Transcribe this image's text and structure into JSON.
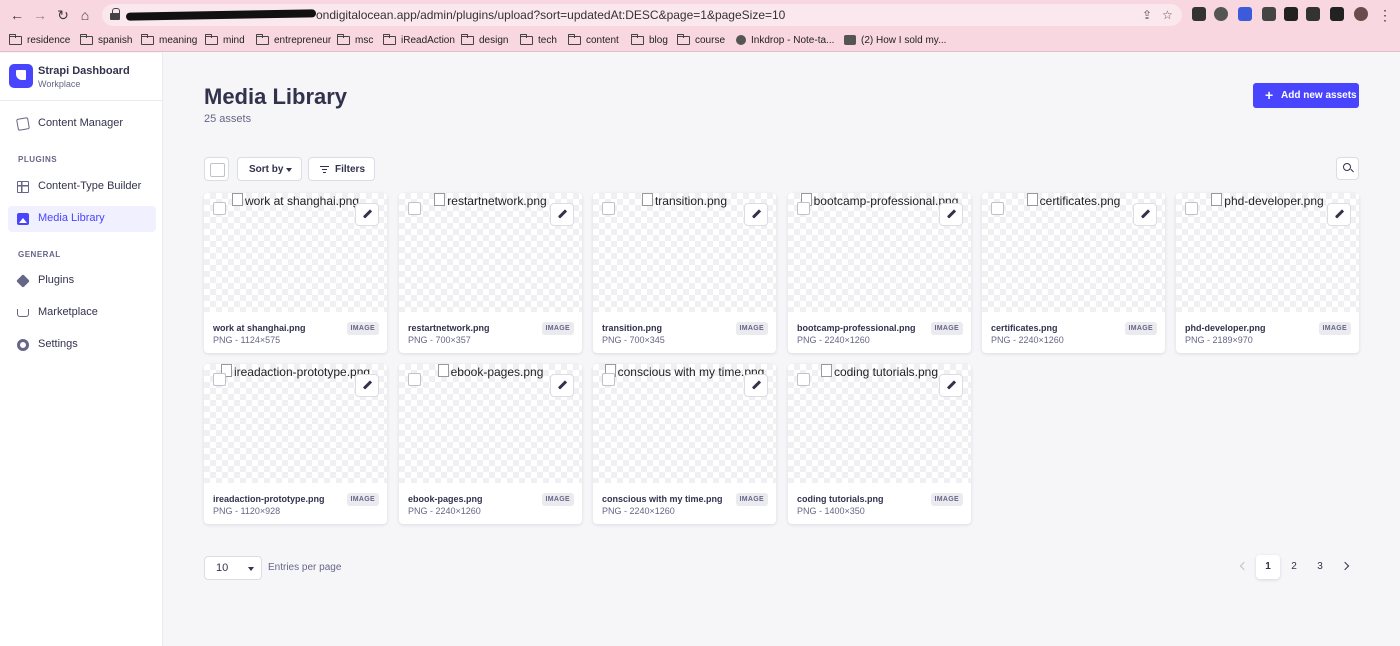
{
  "browser": {
    "url": "ondigitalocean.app/admin/plugins/upload?sort=updatedAt:DESC&page=1&pageSize=10",
    "bookmarks": [
      "residence",
      "spanish",
      "meaning",
      "mind",
      "entrepreneur",
      "msc",
      "iReadAction",
      "design",
      "tech",
      "content",
      "blog",
      "course",
      "Inkdrop - Note-ta...",
      "(2) How I sold my..."
    ]
  },
  "sidebar": {
    "title": "Strapi Dashboard",
    "subtitle": "Workplace",
    "content_manager": "Content Manager",
    "plugins_section": "PLUGINS",
    "plugin_items": [
      "Content-Type Builder",
      "Media Library"
    ],
    "general_section": "GENERAL",
    "general_items": [
      "Plugins",
      "Marketplace",
      "Settings"
    ]
  },
  "header": {
    "title": "Media Library",
    "count": "25 assets",
    "add_button": "Add new assets"
  },
  "toolbar": {
    "sort_label": "Sort by",
    "filters_label": "Filters"
  },
  "assets": [
    {
      "name": "work at shanghai.png",
      "meta": "PNG - 1124×575",
      "type": "IMAGE"
    },
    {
      "name": "restartnetwork.png",
      "meta": "PNG - 700×357",
      "type": "IMAGE"
    },
    {
      "name": "transition.png",
      "meta": "PNG - 700×345",
      "type": "IMAGE"
    },
    {
      "name": "bootcamp-professional.png",
      "meta": "PNG - 2240×1260",
      "type": "IMAGE"
    },
    {
      "name": "certificates.png",
      "meta": "PNG - 2240×1260",
      "type": "IMAGE"
    },
    {
      "name": "phd-developer.png",
      "meta": "PNG - 2189×970",
      "type": "IMAGE"
    },
    {
      "name": "ireadaction-prototype.png",
      "meta": "PNG - 1120×928",
      "type": "IMAGE"
    },
    {
      "name": "ebook-pages.png",
      "meta": "PNG - 2240×1260",
      "type": "IMAGE"
    },
    {
      "name": "conscious with my time.png",
      "meta": "PNG - 2240×1260",
      "type": "IMAGE"
    },
    {
      "name": "coding tutorials.png",
      "meta": "PNG - 1400×350",
      "type": "IMAGE"
    }
  ],
  "footer": {
    "page_size": "10",
    "entries_label": "Entries per page",
    "pages": [
      "1",
      "2",
      "3"
    ],
    "current_page": "1"
  }
}
